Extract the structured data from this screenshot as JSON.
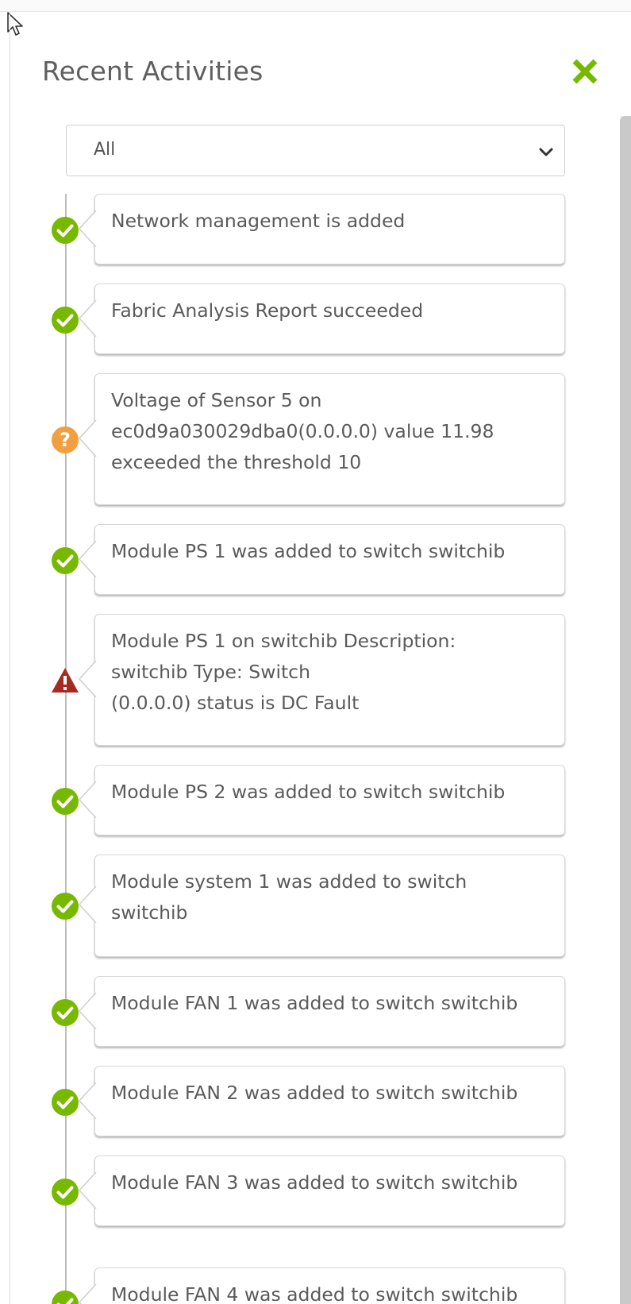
{
  "panel": {
    "title": "Recent Activities",
    "close_icon": "close-x-icon",
    "close_color": "#76b900"
  },
  "filter": {
    "selected": "All",
    "chevron_icon": "chevron-down-icon"
  },
  "status_colors": {
    "success": "#76b900",
    "warning": "#f0a040",
    "critical": "#a42a22"
  },
  "activities": [
    {
      "status": "success",
      "icon": "check-circle-icon",
      "text": "Network management is added"
    },
    {
      "status": "success",
      "icon": "check-circle-icon",
      "text": "Fabric Analysis Report succeeded"
    },
    {
      "status": "warning",
      "icon": "question-circle-icon",
      "text": "Voltage of Sensor 5 on\nec0d9a030029dba0(0.0.0.0) value 11.98\nexceeded the threshold 10"
    },
    {
      "status": "success",
      "icon": "check-circle-icon",
      "text": "Module PS 1 was added to switch switchib"
    },
    {
      "status": "critical",
      "icon": "warning-triangle-icon",
      "text": "Module PS 1 on switchib Description:\nswitchib Type: Switch\n(0.0.0.0) status is DC Fault"
    },
    {
      "status": "success",
      "icon": "check-circle-icon",
      "text": "Module PS 2 was added to switch switchib"
    },
    {
      "status": "success",
      "icon": "check-circle-icon",
      "text": "Module system 1 was added to switch\nswitchib"
    },
    {
      "status": "success",
      "icon": "check-circle-icon",
      "text": "Module FAN 1 was added to switch switchib"
    },
    {
      "status": "success",
      "icon": "check-circle-icon",
      "text": "Module FAN 2 was added to switch switchib"
    },
    {
      "status": "success",
      "icon": "check-circle-icon",
      "text": "Module FAN 3 was added to switch switchib"
    },
    {
      "status": "success",
      "icon": "check-circle-icon",
      "text": "Module FAN 4 was added to switch switchib"
    }
  ]
}
